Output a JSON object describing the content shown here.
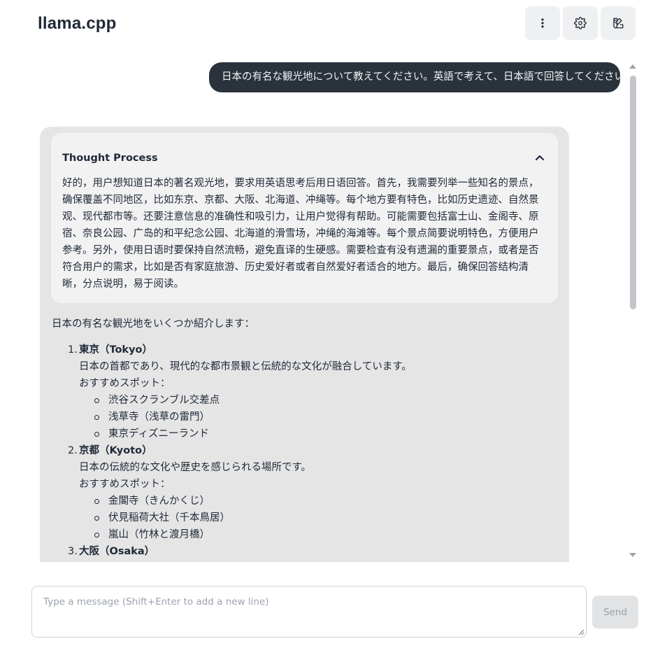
{
  "app": {
    "title": "llama.cpp"
  },
  "header": {
    "buttons": [
      {
        "name": "more-options",
        "icon": "vertical-dots-icon"
      },
      {
        "name": "settings",
        "icon": "gear-icon"
      },
      {
        "name": "theme",
        "icon": "palette-icon"
      }
    ]
  },
  "chat": {
    "user_message": "日本の有名な観光地について教えてください。英語で考えて、日本語で回答してください。",
    "assistant": {
      "thought": {
        "title": "Thought Process",
        "expanded": true,
        "text": "好的，用户想知道日本的著名观光地，要求用英语思考后用日语回答。首先，我需要列举一些知名的景点，确保覆盖不同地区，比如东京、京都、大阪、北海道、冲绳等。每个地方要有特色，比如历史遗迹、自然景观、现代都市等。还要注意信息的准确性和吸引力，让用户觉得有帮助。可能需要包括富士山、金阁寺、原宿、奈良公园、广岛的和平纪念公园、北海道的滑雪场，冲绳的海滩等。每个景点简要说明特色，方便用户参考。另外，使用日语时要保持自然流畅，避免直译的生硬感。需要检查有没有遗漏的重要景点，或者是否符合用户的需求，比如是否有家庭旅游、历史爱好者或者自然爱好者适合的地方。最后，确保回答结构清晰，分点说明，易于阅读。"
      },
      "answer_intro": "日本の有名な観光地をいくつか紹介します：",
      "places": [
        {
          "num": "1.",
          "name": "東京（Tokyo）",
          "desc": "日本の首都であり、現代的な都市景観と伝統的な文化が融合しています。",
          "rec_label": "おすすめスポット：",
          "spots": [
            "渋谷スクランブル交差点",
            "浅草寺（浅草の雷門）",
            "東京ディズニーランド"
          ]
        },
        {
          "num": "2.",
          "name": "京都（Kyoto）",
          "desc": "日本の伝統的な文化や歴史を感じられる場所です。",
          "rec_label": "おすすめスポット：",
          "spots": [
            "金閣寺（きんかくじ）",
            "伏見稲荷大社（千本鳥居）",
            "嵐山（竹林と渡月橋）"
          ]
        },
        {
          "num": "3.",
          "name": "大阪（Osaka）"
        }
      ]
    }
  },
  "composer": {
    "placeholder": "Type a message (Shift+Enter to add a new line)",
    "send_label": "Send"
  }
}
